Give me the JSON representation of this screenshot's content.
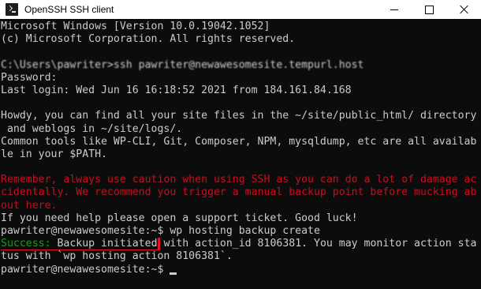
{
  "window": {
    "title": "OpenSSH SSH client",
    "icon": "terminal-icon",
    "controls": [
      "minimize-icon",
      "maximize-icon",
      "close-icon"
    ]
  },
  "terminal": {
    "lines": [
      "Microsoft Windows [Version 10.0.19042.1052]",
      "(c) Microsoft Corporation. All rights reserved.",
      "",
      "C:\\Users\\pawriter>ssh pawriter@newawesomesite.tempurl.host",
      "Password:",
      "Last login: Wed Jun 16 16:18:52 2021 from 184.161.84.168",
      "",
      "Howdy, you can find all your site files in the ~/site/public_html/ directory",
      " and weblogs in ~/site/logs/.",
      "Common tools like WP-CLI, Git, Composer, NPM, mysqldump, etc are all availab",
      "le in your $PATH.",
      "",
      "Remember, always use caution when using SSH as you can do a lot of damage ac",
      "cidentally. We recommend you trigger a manual backup point before mucking ab",
      "out here.",
      "If you need help please open a support ticket. Good luck!",
      "pawriter@newawesomesite:~$ wp hosting backup create",
      "with action_id 8106381. You may monitor action sta",
      "tus with `wp hosting action 8106381`.",
      "pawriter@newawesomesite:~$ "
    ],
    "success_label": "Success:",
    "success_text": " Backup initiated",
    "colors": {
      "background": "#0c0c0c",
      "text": "#cccccc",
      "warning": "#c50f1f",
      "success": "#13a10e",
      "highlight_box": "#e81123"
    }
  }
}
